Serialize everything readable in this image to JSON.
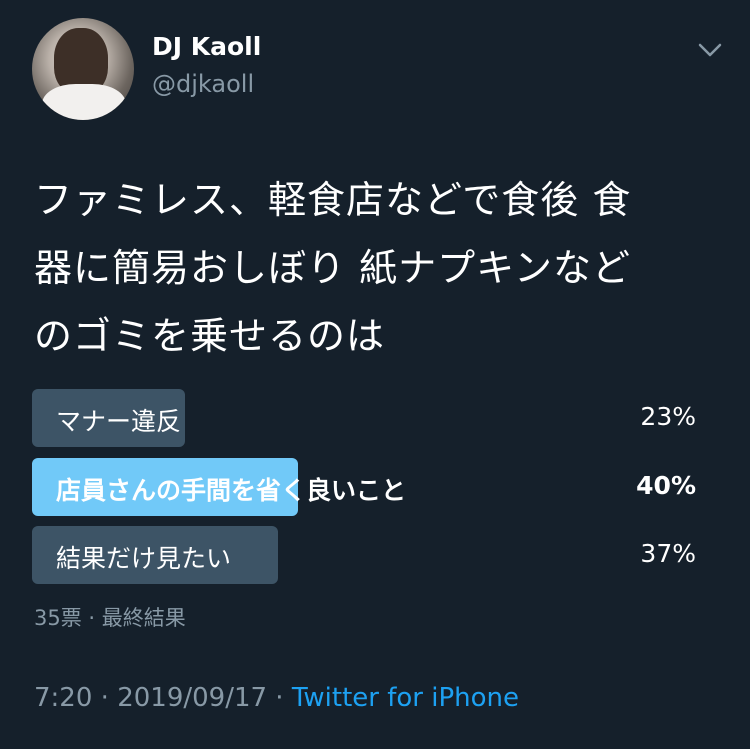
{
  "author": {
    "display_name": "DJ Kaoll",
    "handle": "@djkaoll"
  },
  "tweet": {
    "text_lines": [
      "ファミレス、軽食店などで食後 食",
      "器に簡易おしぼり 紙ナプキンなど",
      "のゴミを乗せるのは"
    ]
  },
  "poll": {
    "options": [
      {
        "label": "マナー違反",
        "percent": "23%",
        "fraction": 0.23,
        "leading": false
      },
      {
        "label": "店員さんの手間を省く良いこと",
        "percent": "40%",
        "fraction": 0.4,
        "leading": true
      },
      {
        "label": "結果だけ見たい",
        "percent": "37%",
        "fraction": 0.37,
        "leading": false
      }
    ],
    "votes": "35票",
    "separator": " · ",
    "status": "最終結果"
  },
  "meta": {
    "time": "7:20",
    "separator": " · ",
    "date": "2019/09/17",
    "separator2": " · ",
    "source": "Twitter for iPhone"
  },
  "colors": {
    "background": "#15202b",
    "bar": "#3d5466",
    "bar_leading": "#71c9f8",
    "muted_text": "#8899a6",
    "link": "#1da1f2"
  },
  "icons": {
    "menu": "chevron-down-icon"
  }
}
